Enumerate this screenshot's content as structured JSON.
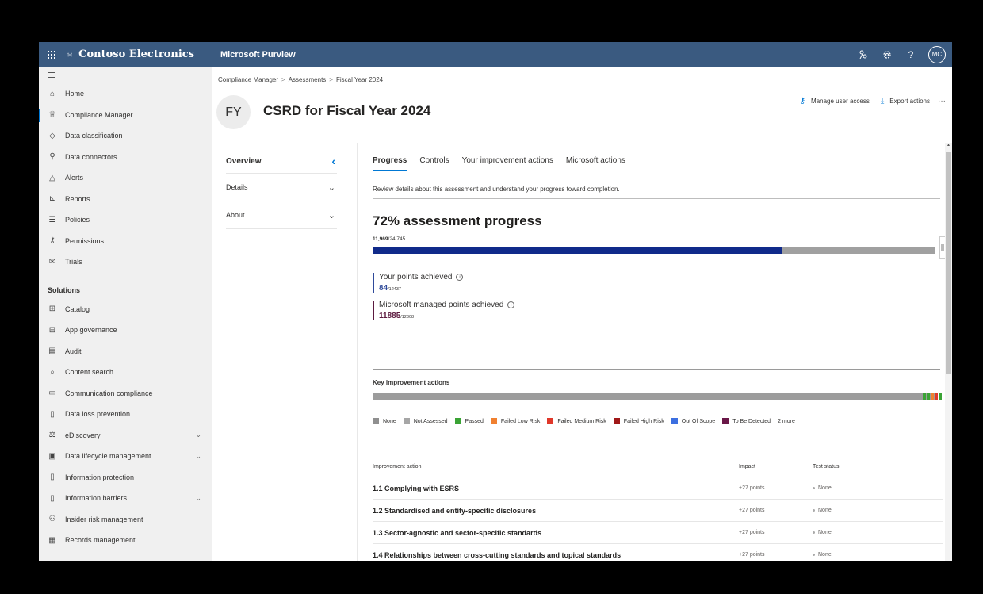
{
  "topbar": {
    "brand_name": "Contoso Electronics",
    "product_name": "Microsoft Purview",
    "avatar_initials": "MC",
    "help_symbol": "?",
    "color": "#3a5a80"
  },
  "nav": {
    "items": [
      {
        "label": "Home",
        "icon": "home-icon",
        "glyph": "⌂"
      },
      {
        "label": "Compliance Manager",
        "icon": "trophy-icon",
        "glyph": "♕",
        "active": true
      },
      {
        "label": "Data classification",
        "icon": "tag-icon",
        "glyph": "◇"
      },
      {
        "label": "Data connectors",
        "icon": "connector-icon",
        "glyph": "⚲"
      },
      {
        "label": "Alerts",
        "icon": "alert-icon",
        "glyph": "△"
      },
      {
        "label": "Reports",
        "icon": "chart-icon",
        "glyph": "⊾"
      },
      {
        "label": "Policies",
        "icon": "policies-icon",
        "glyph": "☰"
      },
      {
        "label": "Permissions",
        "icon": "key-icon",
        "glyph": "⚷"
      },
      {
        "label": "Trials",
        "icon": "trials-icon",
        "glyph": "✉"
      }
    ],
    "solutions_heading": "Solutions",
    "solutions": [
      {
        "label": "Catalog",
        "icon": "catalog-icon",
        "glyph": "⊞"
      },
      {
        "label": "App governance",
        "icon": "app-governance-icon",
        "glyph": "⊟"
      },
      {
        "label": "Audit",
        "icon": "audit-icon",
        "glyph": "▤"
      },
      {
        "label": "Content search",
        "icon": "search-icon",
        "glyph": "⌕"
      },
      {
        "label": "Communication compliance",
        "icon": "chat-icon",
        "glyph": "▭"
      },
      {
        "label": "Data loss prevention",
        "icon": "dlp-icon",
        "glyph": "▯"
      },
      {
        "label": "eDiscovery",
        "icon": "ediscovery-icon",
        "glyph": "⚖",
        "chevron": true
      },
      {
        "label": "Data lifecycle management",
        "icon": "lifecycle-icon",
        "glyph": "▣",
        "chevron": true
      },
      {
        "label": "Information protection",
        "icon": "protection-icon",
        "glyph": "▯"
      },
      {
        "label": "Information barriers",
        "icon": "barriers-icon",
        "glyph": "▯",
        "chevron": true
      },
      {
        "label": "Insider risk management",
        "icon": "insider-risk-icon",
        "glyph": "⚇"
      },
      {
        "label": "Records management",
        "icon": "records-icon",
        "glyph": "▦"
      }
    ]
  },
  "breadcrumb": [
    "Compliance Manager",
    "Assessments",
    "Fiscal Year 2024"
  ],
  "header": {
    "badge": "FY",
    "title": "CSRD for Fiscal Year 2024",
    "manage_access": "Manage user access",
    "export": "Export actions"
  },
  "sidepanel": {
    "items": [
      "Overview",
      "Details",
      "About"
    ]
  },
  "tabs": [
    "Progress",
    "Controls",
    "Your improvement actions",
    "Microsoft actions"
  ],
  "description": "Review details about this assessment and understand your progress toward completion.",
  "progress": {
    "title": "72% assessment progress",
    "achieved": "11,969",
    "total": "/24,745",
    "fraction": 0.7285,
    "bar_color": "#102a8a"
  },
  "points": {
    "your_label": "Your points achieved",
    "your_value": "84",
    "your_total": "/12437",
    "ms_label": "Microsoft managed points achieved",
    "ms_value": "11885",
    "ms_total": "/12308"
  },
  "key_actions": {
    "title": "Key improvement actions",
    "legend": [
      {
        "label": "None",
        "color": "#8f8f8f"
      },
      {
        "label": "Not Assessed",
        "color": "#a6a6a6"
      },
      {
        "label": "Passed",
        "color": "#3aa335"
      },
      {
        "label": "Failed Low Risk",
        "color": "#f08030"
      },
      {
        "label": "Failed Medium Risk",
        "color": "#e0382a"
      },
      {
        "label": "Failed High Risk",
        "color": "#a01818"
      },
      {
        "label": "Out Of Scope",
        "color": "#3c6fe0"
      },
      {
        "label": "To Be Detected",
        "color": "#6a1748"
      }
    ],
    "more": "2 more"
  },
  "table": {
    "headers": [
      "Improvement action",
      "Impact",
      "Test status"
    ],
    "rows": [
      {
        "action": "1.1  Complying with ESRS",
        "impact": "+27 points",
        "status": "None"
      },
      {
        "action": "1.2  Standardised and entity-specific disclosures",
        "impact": "+27 points",
        "status": "None"
      },
      {
        "action": "1.3  Sector-agnostic and sector-specific standards",
        "impact": "+27 points",
        "status": "None"
      },
      {
        "action": "1.4  Relationships between cross-cutting standards and topical standards",
        "impact": "+27 points",
        "status": "None"
      }
    ]
  }
}
